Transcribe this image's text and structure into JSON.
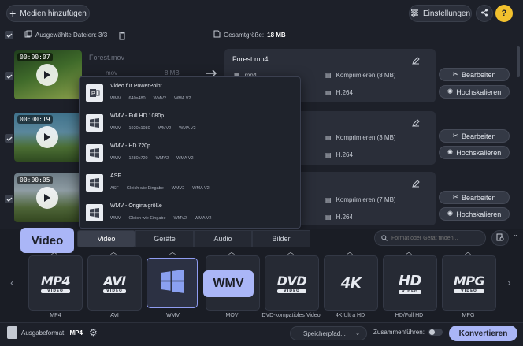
{
  "toolbar": {
    "add_media": "Medien hinzufügen",
    "settings": "Einstellungen",
    "help": "?"
  },
  "filebar": {
    "selected_label": "Ausgewählte Dateien: 3/3",
    "total_size_label": "Gesamtgröße:",
    "total_size_value": "18 MB"
  },
  "files": [
    {
      "time": "00:00:07",
      "input_name": "Forest.mov",
      "input_format": "mov",
      "input_size": "8 MB",
      "output_name": "Forest.mp4",
      "output_format": "mp4",
      "compress": "Komprimieren (8 MB)",
      "codec": "H.264",
      "edit": "Bearbeiten",
      "upscale": "Hochskalieren",
      "colors": [
        "#2f5a2a",
        "#6b8f3c"
      ]
    },
    {
      "time": "00:00:19",
      "compress": "Komprimieren (3 MB)",
      "codec": "H.264",
      "edit": "Bearbeiten",
      "upscale": "Hochskalieren",
      "colors": [
        "#3d6c86",
        "#5a7d3f"
      ]
    },
    {
      "time": "00:00:05",
      "compress": "Komprimieren (7 MB)",
      "codec": "H.264",
      "edit": "Bearbeiten",
      "upscale": "Hochskalieren",
      "colors": [
        "#5b6a74",
        "#42562e"
      ]
    }
  ],
  "dropdown": [
    {
      "title": "Video für PowerPoint",
      "specs": [
        "WMV",
        "640x480",
        "WMV2",
        "WMA V2"
      ],
      "icon": "powerpoint-icon"
    },
    {
      "title": "WMV - Full HD 1080p",
      "specs": [
        "WMV",
        "1920x1080",
        "WMV2",
        "WMA V2"
      ],
      "icon": "windows-icon"
    },
    {
      "title": "WMV - HD 720p",
      "specs": [
        "WMV",
        "1280x720",
        "WMV2",
        "WMA V2"
      ],
      "icon": "windows-icon"
    },
    {
      "title": "ASF",
      "specs": [
        "ASF",
        "Gleich wie Eingabe",
        "WMV2",
        "WMA V2"
      ],
      "icon": "windows-icon"
    },
    {
      "title": "WMV - Originalgröße",
      "specs": [
        "WMV",
        "Gleich wie Eingabe",
        "WMV2",
        "WMA V2"
      ],
      "icon": "windows-icon"
    }
  ],
  "tabs": [
    "Video",
    "Geräte",
    "Audio",
    "Bilder"
  ],
  "search": {
    "placeholder": "Format oder Gerät finden..."
  },
  "formats": [
    {
      "logo": "MP4",
      "sub": "VIDEO",
      "label": "MP4"
    },
    {
      "logo": "AVI",
      "sub": "VIDEO",
      "label": "AVI"
    },
    {
      "logo": "",
      "sub": "",
      "label": "WMV"
    },
    {
      "logo": "",
      "sub": "",
      "label": "MOV"
    },
    {
      "logo": "DVD",
      "sub": "VIDEO",
      "label": "DVD-kompatibles Video"
    },
    {
      "logo": "4K",
      "sub": "",
      "label": "4K Ultra HD"
    },
    {
      "logo": "HD",
      "sub": "VIDEO",
      "label": "HD/Full HD"
    },
    {
      "logo": "MPG",
      "sub": "VIDEO",
      "label": "MPG"
    }
  ],
  "callouts": {
    "video": "Video",
    "wmv": "WMV"
  },
  "footer": {
    "output_format_label": "Ausgabeformat:",
    "output_format_value": "MP4",
    "save_path": "Speicherpfad...",
    "merge_label": "Zusammenführen:",
    "convert": "Konvertieren"
  },
  "colors": {
    "accent": "#aab6f7",
    "bg": "#1d2029"
  }
}
